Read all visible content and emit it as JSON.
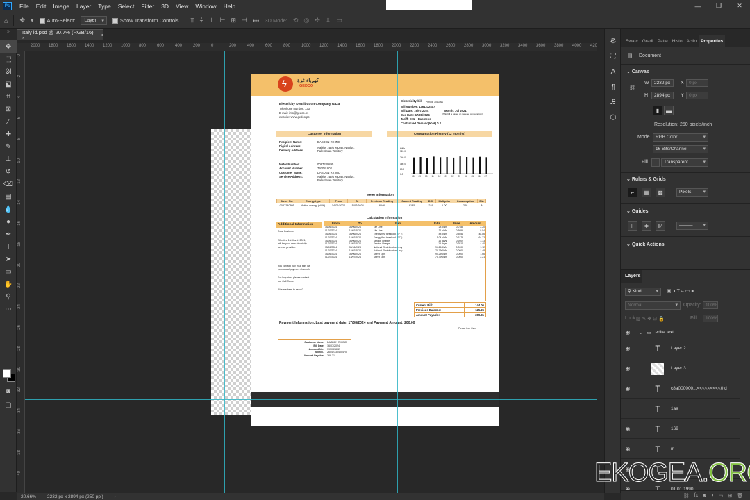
{
  "menu": {
    "logo": "Ps",
    "items": [
      "File",
      "Edit",
      "Image",
      "Layer",
      "Type",
      "Select",
      "Filter",
      "3D",
      "View",
      "Window",
      "Help"
    ],
    "window_controls": [
      "—",
      "❐",
      "✕"
    ]
  },
  "options_bar": {
    "auto_select_label": "Auto-Select:",
    "auto_select_value": "Layer",
    "show_transform_label": "Show Transform Controls",
    "mode_3d_label": "3D Mode:",
    "more_label": "•••"
  },
  "document_tab": {
    "title": "Italy id.psd @ 20.7% (RGB/16) *",
    "close": "×"
  },
  "ruler_ticks_h": [
    "2000",
    "1800",
    "1600",
    "1400",
    "1200",
    "1000",
    "800",
    "600",
    "400",
    "200",
    "0",
    "200",
    "400",
    "600",
    "800",
    "1000",
    "1200",
    "1400",
    "1600",
    "1800",
    "2000",
    "2200",
    "2400",
    "2600",
    "2800",
    "3000",
    "3200",
    "3400",
    "3600",
    "3800",
    "4000",
    "4200"
  ],
  "ruler_ticks_v": [
    "0",
    "2",
    "4",
    "6",
    "8",
    "10",
    "12",
    "14",
    "16",
    "18",
    "20",
    "22",
    "24",
    "26",
    "28",
    "30",
    "32",
    "34",
    "36",
    "38",
    "40"
  ],
  "bill": {
    "logo_arabic": "كهرباء غزة",
    "logo_name": "GEDCO",
    "company": "Electricity Distribution Company Gaza",
    "telephone": "Telephone number: 133",
    "email": "E-mail: info@gedco.ps",
    "website": "website: www.gedco.ps",
    "bill_title": "Electricity bill",
    "period": "Period: 30 Days",
    "bill_number": "Bill Number: 4364332407",
    "bill_date": "Bill Date: 16/07/2024",
    "month": "Month: Jul 2021",
    "month_note": "(This bill is based on metered consumption)",
    "due_date": "Due Date: 17/08/2024",
    "tariff": "Tariff: E01 – Business",
    "contracted_demand": "Contracted Demand(KVA) 0.2",
    "customer_info_title": "Customer Information",
    "consumption_title": "Consumption History (12 months)",
    "recipient_label": "Recipient Name:",
    "recipient_value": "DASDEN RX INC",
    "digital_label": "Digital Address:",
    "delivery_label": "Delivery Address:",
    "delivery_value": "Nablus , Beit wazan, Nablus, Palestinian Territory",
    "meter_label": "Meter Number:",
    "meter_value": "0087240895",
    "account_label": "Account Number:",
    "account_value": "793081802",
    "customer_name_label": "Customer Name:",
    "customer_name_value": "DASDEN RX INC",
    "service_label": "Service Address:",
    "service_value": "Nablus , Beit wazan, Nablus, Palestinian Territory",
    "meter_info_title": "Meter Information",
    "meter_headers": [
      "Meter No.",
      "Energy type",
      "From",
      "To",
      "Previous Reading",
      "Current Reading",
      "Diff.",
      "Multiplier",
      "Consumption",
      "E/A"
    ],
    "meter_row": [
      "0087240895",
      "Active energy (kWh)",
      "14/06/2024",
      "15/07/2024",
      "8846",
      "9185",
      "249",
      "1.00",
      "249",
      "A"
    ],
    "calc_title": "Calculation Information",
    "additional_title": "Additional Information",
    "calc_headers": [
      "From",
      "To",
      "Item",
      "Units",
      "Price",
      "Amount"
    ],
    "calc_rows": [
      [
        "15/06/2024",
        "30/06/2024",
        "Life Line",
        "28 kWh",
        "0.0788",
        "2.20"
      ],
      [
        "01/07/2024",
        "15/07/2024",
        "Life Line",
        "31 kWh",
        "0.3055",
        "9.54"
      ],
      [
        "15/06/2024",
        "30/06/2024",
        "Energy first threshold (EFT)",
        "88 kWh",
        "0.5554",
        "48.86"
      ],
      [
        "01/07/2024",
        "15/07/2024",
        "Energy first threshold (EFT)",
        "104 kWh",
        "0.6178",
        "64.22"
      ],
      [
        "15/06/2024",
        "30/06/2024",
        "Service Charge",
        "16 days",
        "0.2002",
        "3.33"
      ],
      [
        "01/07/2024",
        "15/07/2024",
        "Service Charge",
        "15 days",
        "0.2914",
        "4.40"
      ],
      [
        "15/06/2024",
        "30/06/2024",
        "National Electrification Levy",
        "95.25GWh",
        "0.0000",
        "1.12"
      ],
      [
        "01/07/2024",
        "15/07/2024",
        "National Electrification Levy",
        "73.79GWh",
        "0.0000",
        "1.48"
      ],
      [
        "15/06/2024",
        "30/06/2024",
        "Street Light",
        "95.25GWh",
        "0.0000",
        "1.66"
      ],
      [
        "01/07/2024",
        "15/07/2024",
        "Street Light",
        "73.79GWh",
        "0.0000",
        "2.21"
      ]
    ],
    "additional_lines": [
      "Dear Customer",
      "Effective 1st March 2021,",
      "will be your new electricity",
      "service provider.",
      "You can still pay your bills via",
      "your usual payment channels",
      "For Inquiries, please contact",
      "our Call Center",
      "\"We are here to serve\""
    ],
    "current_bill_label": "Current Bill:",
    "current_bill_value": "144.06",
    "prev_balance_label": "Previous Balance:",
    "prev_balance_value": "125.25",
    "amount_payable_label": "Amount Payable:",
    "amount_payable_value": "269.31",
    "payment_line": "Payment Information. Last payment date: 17/08/2024 and Payment Amount:   200.00",
    "tear_note": "Please tear Over",
    "stub_lines": [
      [
        "Customer Name:",
        "DASDEN RX INC"
      ],
      [
        "Bill Date:",
        "16/07/2024"
      ],
      [
        "Account No.:",
        "793081802"
      ],
      [
        "Bill No.:",
        "26042330400470"
      ],
      [
        "Amount Payable:",
        "269.31"
      ]
    ],
    "chart_unit": "kWh",
    "chart_yticks": [
      "320.0",
      "240.0",
      "160.0",
      "80.0",
      "0.0"
    ],
    "chart_months": [
      "08",
      "09",
      "10",
      "11",
      "12",
      "01",
      "02",
      "03",
      "04",
      "05",
      "06",
      "07"
    ]
  },
  "properties_panel": {
    "tabs": [
      "Swatc",
      "Gradi",
      "Patte",
      "Histo",
      "Actio",
      "Properties"
    ],
    "document_label": "Document",
    "canvas_title": "Canvas",
    "w_label": "W",
    "w_value": "2232 px",
    "h_label": "H",
    "h_value": "2894 px",
    "x_label": "X",
    "x_value": "0 px",
    "y_label": "Y",
    "y_value": "0 px",
    "resolution": "Resolution: 250 pixels/inch",
    "mode_label": "Mode",
    "mode_value": "RGB Color",
    "bit_value": "16 Bits/Channel",
    "fill_label": "Fill",
    "fill_value": "Transparent",
    "rulers_title": "Rulers & Grids",
    "units_value": "Pixels",
    "guides_title": "Guides",
    "quick_actions_title": "Quick Actions"
  },
  "layers_panel": {
    "title": "Layers",
    "kind_label": "Kind",
    "blend_mode": "Normal",
    "opacity_label": "Opacity:",
    "opacity_value": "100%",
    "lock_label": "Lock:",
    "fill_label": "Fill:",
    "fill_value": "100%",
    "group_name": "edite text",
    "layers": [
      {
        "name": "Layer 2",
        "type": "text"
      },
      {
        "name": "Layer 3",
        "type": "image"
      },
      {
        "name": "c8a000000...<<<<<<<<<0 d",
        "type": "text"
      },
      {
        "name": "1aa",
        "type": "text"
      },
      {
        "name": "169",
        "type": "text"
      },
      {
        "name": "m",
        "type": "text"
      },
      {
        "name": "",
        "type": "text"
      },
      {
        "name": "01.01.1990",
        "type": "text"
      }
    ]
  },
  "status_bar": {
    "zoom": "20.66%",
    "doc_info": "2232 px x 2894 px (250 ppi)",
    "arrow": "›"
  },
  "watermark": {
    "part1": "EKOGEA.",
    "part2": "ORG"
  }
}
